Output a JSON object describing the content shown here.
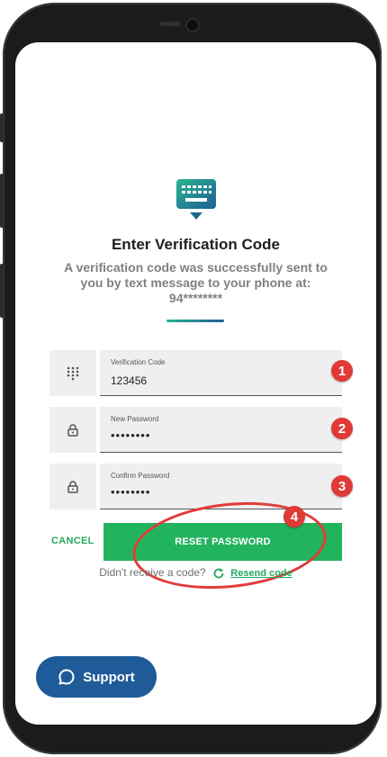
{
  "screen": {
    "title": "Enter Verification Code",
    "message_line1": "A verification code was successfully sent to",
    "message_line2": "you by text message to your phone at:",
    "phone_masked": "94********"
  },
  "fields": [
    {
      "label": "Verification Code",
      "value": "123456",
      "icon": "keypad-icon",
      "step": "1"
    },
    {
      "label": "New Password",
      "value": "••••••••",
      "icon": "lock-icon",
      "step": "2"
    },
    {
      "label": "Confirm Password",
      "value": "••••••••",
      "icon": "lock-icon",
      "step": "3"
    }
  ],
  "actions": {
    "cancel_label": "CANCEL",
    "reset_label": "RESET PASSWORD",
    "reset_step": "4"
  },
  "resend": {
    "prompt": "Didn't receive a code?",
    "link_label": "Resend code",
    "icon": "refresh-icon"
  },
  "support": {
    "label": "Support",
    "icon": "chat-bubble-icon"
  },
  "colors": {
    "primary_green": "#22b35e",
    "brand_blue": "#1f5b98",
    "annotation_red": "#e03a37",
    "keyboard_icon_gradient": [
      "#2ab38f",
      "#1f5f95"
    ]
  }
}
